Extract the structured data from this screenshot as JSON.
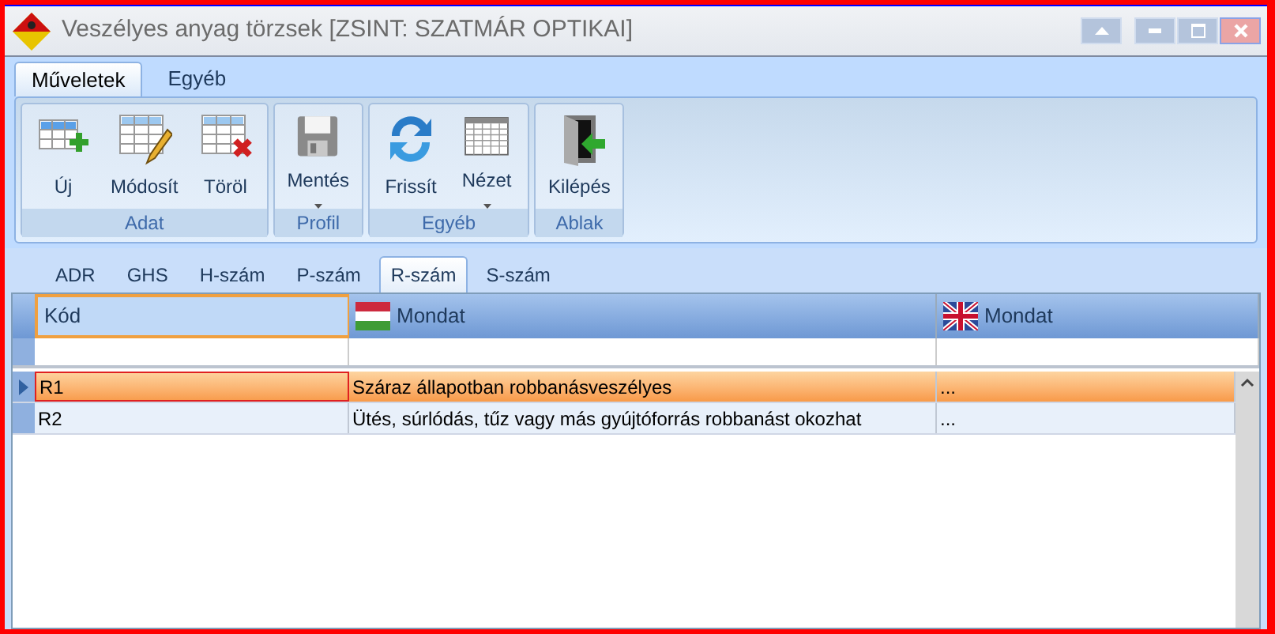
{
  "window": {
    "title": "Veszélyes anyag törzsek [ZSINT: SZATMÁR OPTIKAI]"
  },
  "ribbon_tabs": [
    {
      "label": "Műveletek",
      "selected": true
    },
    {
      "label": "Egyéb",
      "selected": false
    }
  ],
  "ribbon_groups": [
    {
      "label": "Adat",
      "buttons": [
        {
          "kind": "new",
          "label": "Új",
          "dropdown": false
        },
        {
          "kind": "edit",
          "label": "Módosít",
          "dropdown": false
        },
        {
          "kind": "delete",
          "label": "Töröl",
          "dropdown": false
        }
      ]
    },
    {
      "label": "Profil",
      "buttons": [
        {
          "kind": "save",
          "label": "Mentés",
          "dropdown": true
        }
      ]
    },
    {
      "label": "Egyéb",
      "buttons": [
        {
          "kind": "refresh",
          "label": "Frissít",
          "dropdown": false
        },
        {
          "kind": "view",
          "label": "Nézet",
          "dropdown": true
        }
      ]
    },
    {
      "label": "Ablak",
      "buttons": [
        {
          "kind": "exit",
          "label": "Kilépés",
          "dropdown": false
        }
      ]
    }
  ],
  "tabs": [
    {
      "label": "ADR",
      "selected": false
    },
    {
      "label": "GHS",
      "selected": false
    },
    {
      "label": "H-szám",
      "selected": false
    },
    {
      "label": "P-szám",
      "selected": false
    },
    {
      "label": "R-szám",
      "selected": true
    },
    {
      "label": "S-szám",
      "selected": false
    }
  ],
  "table": {
    "columns": [
      {
        "label": "Kód",
        "kind": "plain"
      },
      {
        "label": "Mondat",
        "kind": "hu"
      },
      {
        "label": "Mondat",
        "kind": "gb"
      }
    ],
    "rows": [
      {
        "cells": [
          "R1",
          "Száraz állapotban robbanásveszélyes",
          "..."
        ],
        "selected": true
      },
      {
        "cells": [
          "R2",
          "Ütés, súrlódás, tűz vagy más gyújtóforrás robbanást okozhat",
          "..."
        ],
        "selected": false
      }
    ]
  }
}
